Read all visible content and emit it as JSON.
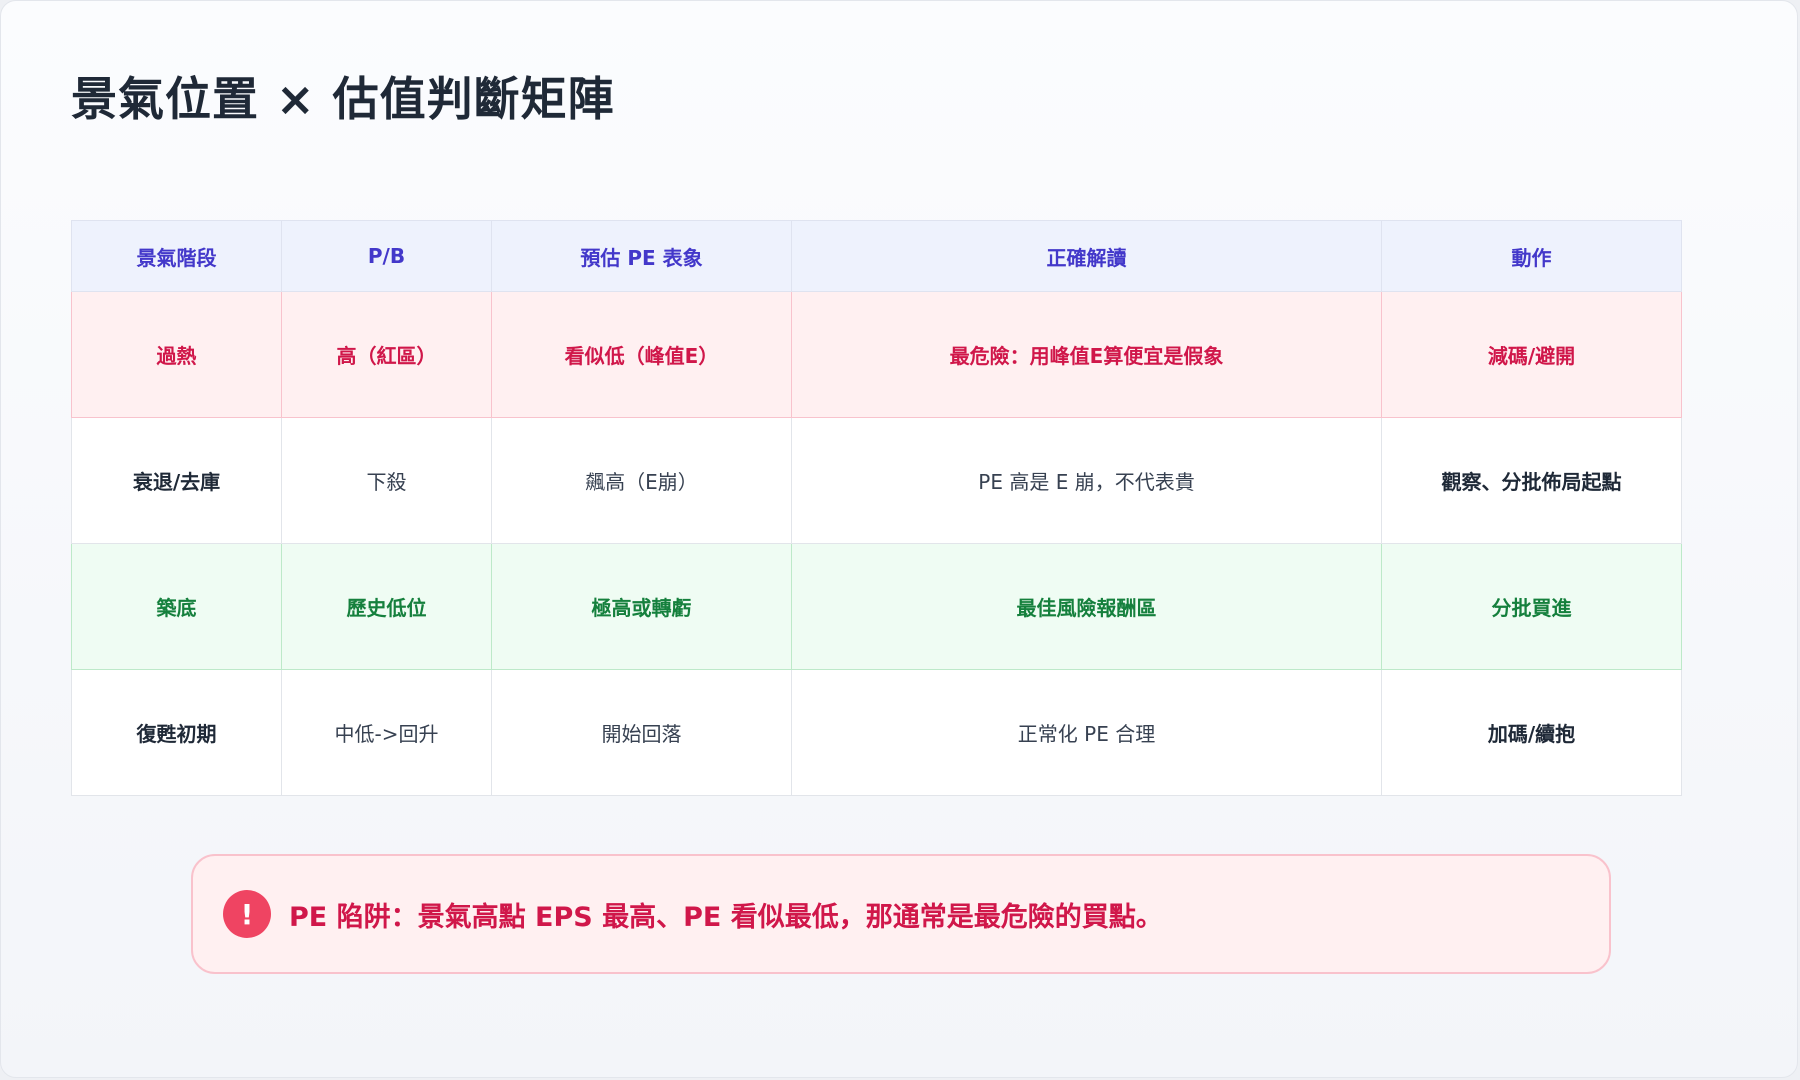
{
  "title": "景氣位置 × 估值判斷矩陣",
  "table": {
    "headers": [
      "景氣階段",
      "P/B",
      "預估 PE 表象",
      "正確解讀",
      "動作"
    ],
    "rows": [
      [
        "過熱",
        "高（紅區）",
        "看似低（峰值E）",
        "最危險：用峰值E算便宜是假象",
        "減碼/避開"
      ],
      [
        "衰退/去庫",
        "下殺",
        "飆高（E崩）",
        "PE 高是 E 崩，不代表貴",
        "觀察、分批佈局起點"
      ],
      [
        "築底",
        "歷史低位",
        "極高或轉虧",
        "最佳風險報酬區",
        "分批買進"
      ],
      [
        "復甦初期",
        "中低->回升",
        "開始回落",
        "正常化 PE 合理",
        "加碼/續抱"
      ]
    ]
  },
  "warning": {
    "icon": "exclamation-icon",
    "icon_glyph": "!",
    "text": "PE 陷阱：景氣高點 EPS 最高、PE 看似最低，那通常是最危險的買點。"
  },
  "colors": {
    "header_text": "#4338ca",
    "overheat": "#d0174a",
    "bottom": "#15803d",
    "warning_icon": "#ef4462"
  }
}
